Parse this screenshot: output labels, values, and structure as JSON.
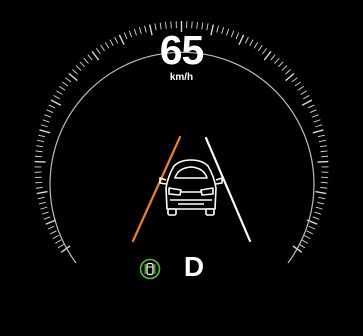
{
  "speed": {
    "value": "65",
    "unit": "km/h"
  },
  "gear": {
    "label": "D"
  },
  "icons": {
    "dial": "speedometer-dial-icon",
    "car": "ego-car-icon",
    "lane_left": "lane-line-left-icon",
    "lane_right": "lane-line-right-icon",
    "lane_assist": "lane-keep-assist-icon"
  },
  "colors": {
    "background": "#000000",
    "text": "#ffffff",
    "dial": "#d9d9d9",
    "lane_left": "#f07f2a",
    "lane_right": "#ffffff",
    "lane_assist": "#52c234"
  }
}
